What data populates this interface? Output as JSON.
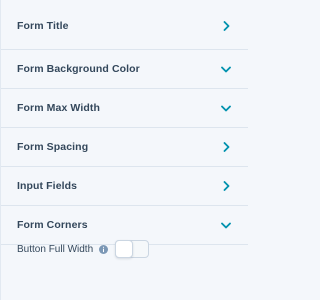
{
  "sections": [
    {
      "label": "Form Title",
      "icon": "chevron-right-icon"
    },
    {
      "label": "Form Background Color",
      "icon": "chevron-down-icon"
    },
    {
      "label": "Form Max Width",
      "icon": "chevron-down-icon"
    },
    {
      "label": "Form Spacing",
      "icon": "chevron-right-icon"
    },
    {
      "label": "Input Fields",
      "icon": "chevron-right-icon"
    },
    {
      "label": "Form Corners",
      "icon": "chevron-down-icon"
    }
  ],
  "button_full_width": {
    "label": "Button Full Width",
    "info_icon": "info-icon",
    "toggle_state": "off"
  },
  "colors": {
    "accent": "#0091ae",
    "text": "#33475b",
    "background": "#f4f7fb",
    "divider": "#dde5ee",
    "info_icon": "#7c98b6"
  }
}
